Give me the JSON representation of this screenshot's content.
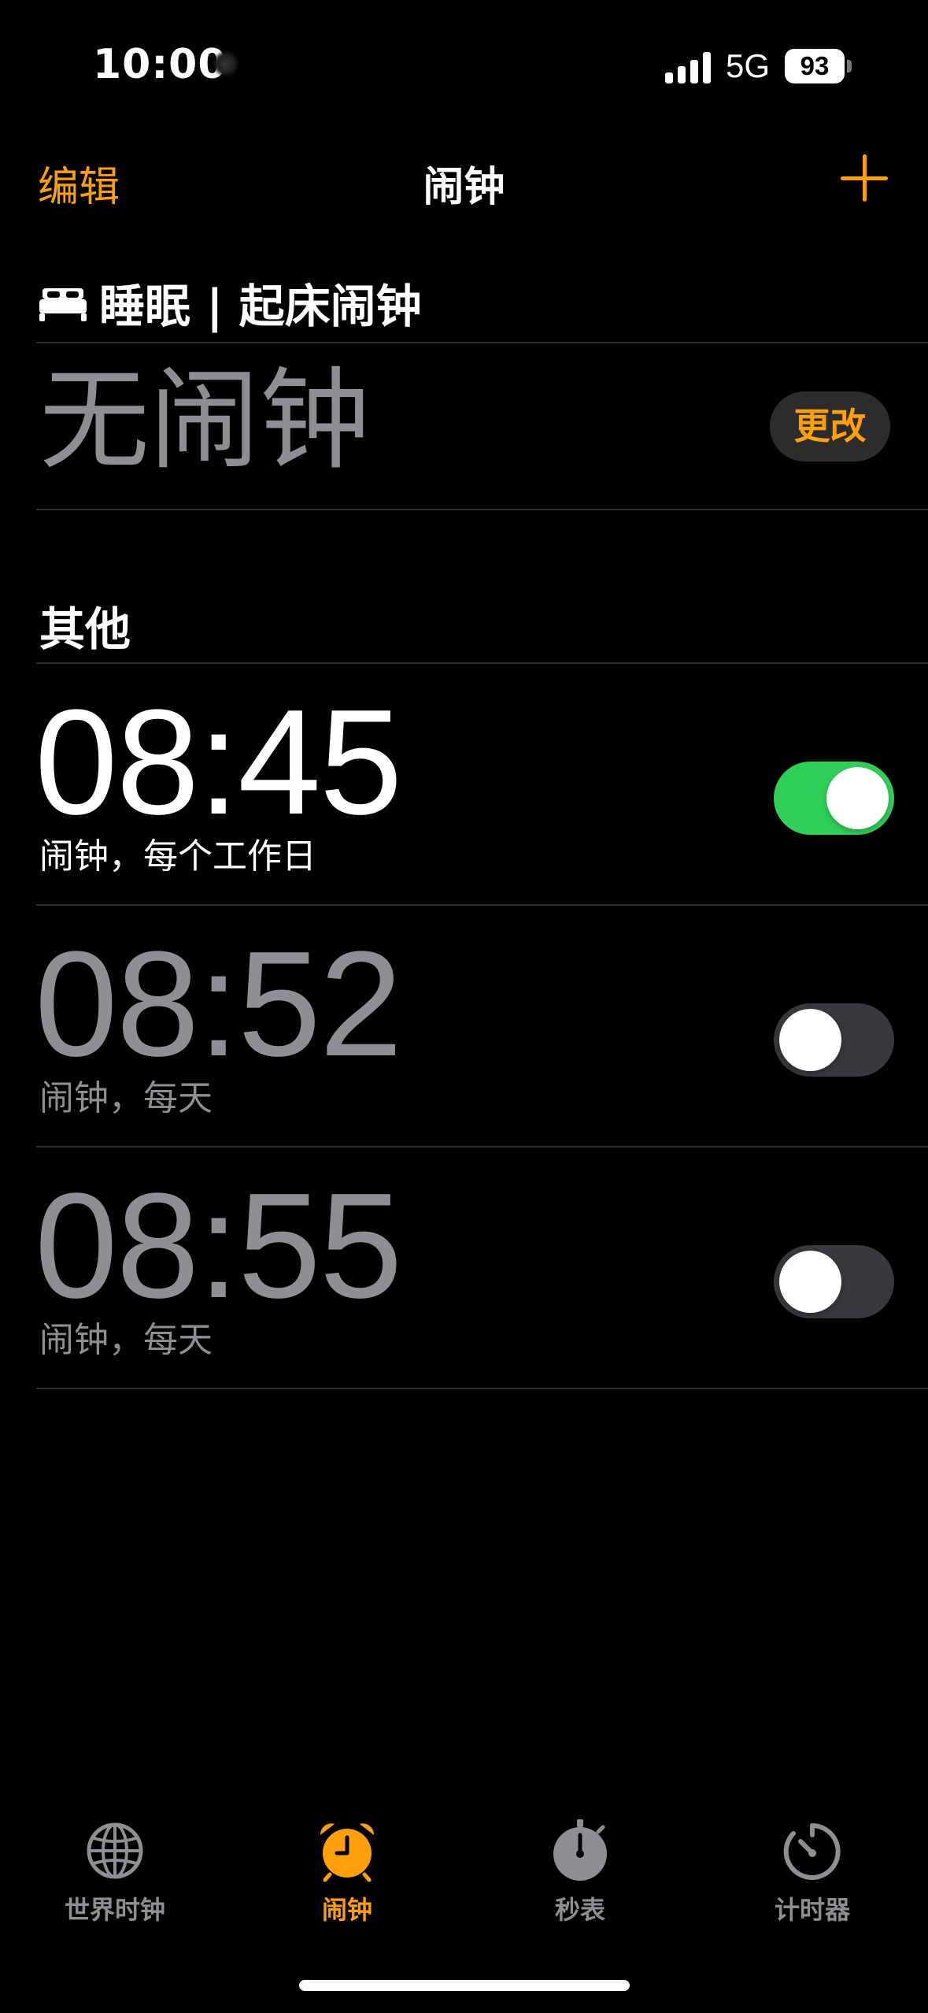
{
  "status_bar": {
    "time": "10:00",
    "network": "5G",
    "battery": "93"
  },
  "nav": {
    "edit": "编辑",
    "title": "闹钟",
    "add_icon": "plus-icon"
  },
  "sleep": {
    "icon": "bed-icon",
    "header": "睡眠 | 起床闹钟",
    "no_alarm": "无闹钟",
    "change_button": "更改"
  },
  "other": {
    "header": "其他",
    "alarms": [
      {
        "time": "08:45",
        "label": "闹钟，每个工作日",
        "enabled": true
      },
      {
        "time": "08:52",
        "label": "闹钟，每天",
        "enabled": false
      },
      {
        "time": "08:55",
        "label": "闹钟，每天",
        "enabled": false
      }
    ]
  },
  "tab_bar": {
    "items": [
      {
        "label": "世界时钟",
        "icon": "globe-icon",
        "active": false
      },
      {
        "label": "闹钟",
        "icon": "alarm-clock-icon",
        "active": true
      },
      {
        "label": "秒表",
        "icon": "stopwatch-icon",
        "active": false
      },
      {
        "label": "计时器",
        "icon": "timer-icon",
        "active": false
      }
    ]
  },
  "colors": {
    "accent": "#ff9f0a",
    "toggle_on": "#30d158",
    "toggle_off": "#39393d",
    "secondary_text": "#8e8e93"
  }
}
